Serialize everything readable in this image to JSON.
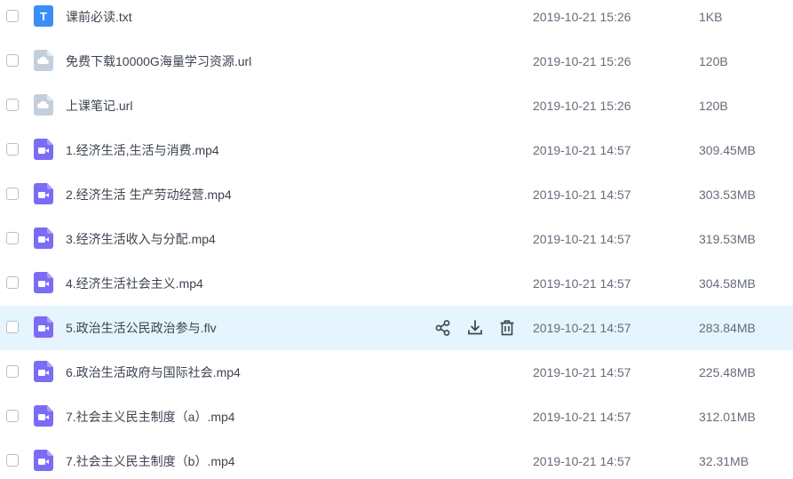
{
  "files": [
    {
      "name": "课前必读.txt",
      "date": "2019-10-21 15:26",
      "size": "1KB",
      "icon": "txt-file-icon",
      "icon_letter": "T",
      "hover": false
    },
    {
      "name": "免费下载10000G海量学习资源.url",
      "date": "2019-10-21 15:26",
      "size": "120B",
      "icon": "url-file-icon",
      "hover": false
    },
    {
      "name": "上课笔记.url",
      "date": "2019-10-21 15:26",
      "size": "120B",
      "icon": "url-file-icon",
      "hover": false
    },
    {
      "name": "1.经济生活,生活与消费.mp4",
      "date": "2019-10-21 14:57",
      "size": "309.45MB",
      "icon": "video-file-icon",
      "hover": false
    },
    {
      "name": "2.经济生活 生产劳动经营.mp4",
      "date": "2019-10-21 14:57",
      "size": "303.53MB",
      "icon": "video-file-icon",
      "hover": false
    },
    {
      "name": "3.经济生活收入与分配.mp4",
      "date": "2019-10-21 14:57",
      "size": "319.53MB",
      "icon": "video-file-icon",
      "hover": false
    },
    {
      "name": "4.经济生活社会主义.mp4",
      "date": "2019-10-21 14:57",
      "size": "304.58MB",
      "icon": "video-file-icon",
      "hover": false
    },
    {
      "name": "5.政治生活公民政治参与.flv",
      "date": "2019-10-21 14:57",
      "size": "283.84MB",
      "icon": "video-file-icon",
      "hover": true
    },
    {
      "name": "6.政治生活政府与国际社会.mp4",
      "date": "2019-10-21 14:57",
      "size": "225.48MB",
      "icon": "video-file-icon",
      "hover": false
    },
    {
      "name": "7.社会主义民主制度（a）.mp4",
      "date": "2019-10-21 14:57",
      "size": "312.01MB",
      "icon": "video-file-icon",
      "hover": false
    },
    {
      "name": "7.社会主义民主制度（b）.mp4",
      "date": "2019-10-21 14:57",
      "size": "32.31MB",
      "icon": "video-file-icon",
      "hover": false
    }
  ],
  "row_actions": [
    "share-icon",
    "download-icon",
    "delete-icon"
  ],
  "colors": {
    "hover_background": "#e5f4fd",
    "txt_icon": "#3a8ef6",
    "url_icon": "#c3cfdb",
    "video_icon": "#7b6cf6"
  }
}
